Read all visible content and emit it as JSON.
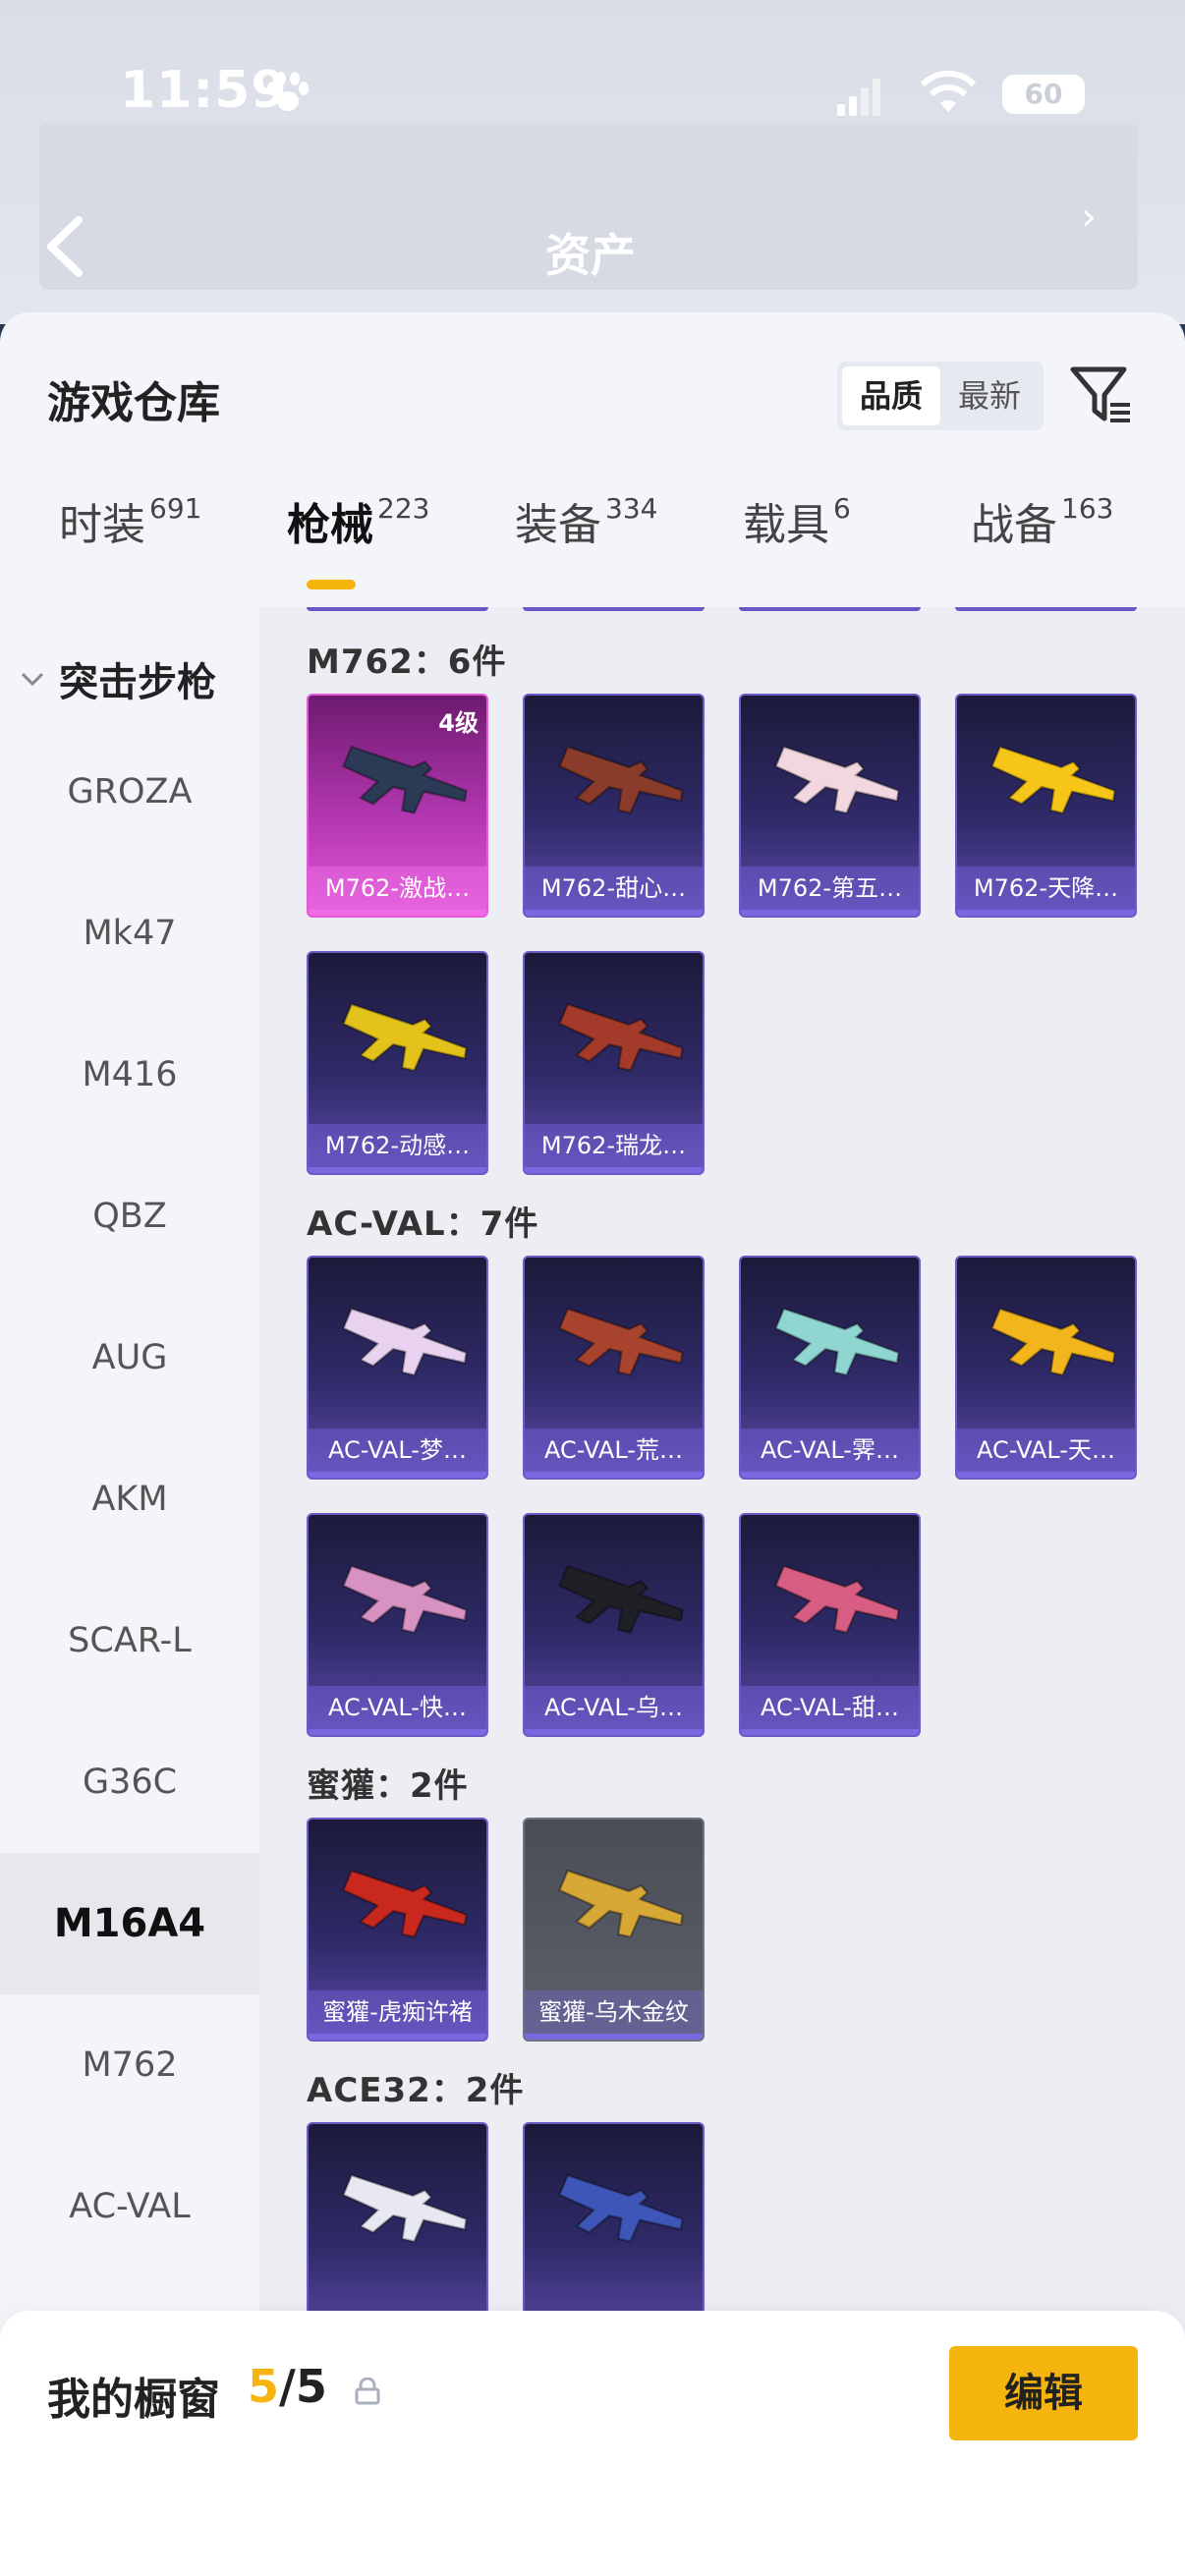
{
  "status": {
    "time": "11:59",
    "battery": "60"
  },
  "background_header": {
    "title": "资产"
  },
  "sheet": {
    "title": "游戏仓库",
    "sort": {
      "quality": "品质",
      "latest": "最新"
    }
  },
  "tabs": [
    {
      "label": "时装",
      "count": "691"
    },
    {
      "label": "枪械",
      "count": "223"
    },
    {
      "label": "装备",
      "count": "334"
    },
    {
      "label": "载具",
      "count": "6"
    },
    {
      "label": "战备",
      "count": "163"
    }
  ],
  "sidebar": {
    "category": "突击步枪",
    "items": [
      "GROZA",
      "Mk47",
      "M416",
      "QBZ",
      "AUG",
      "AKM",
      "SCAR-L",
      "G36C",
      "M16A4",
      "M762",
      "AC-VAL"
    ],
    "active": "M16A4"
  },
  "sections": [
    {
      "title": "M762：6件",
      "items": [
        {
          "name": "M762-激战…",
          "level": "4级",
          "style": "pink",
          "color": "#2b3a55"
        },
        {
          "name": "M762-甜心…",
          "style": "blue",
          "color": "#8a3b2a"
        },
        {
          "name": "M762-第五…",
          "style": "blue",
          "color": "#f2d6e0"
        },
        {
          "name": "M762-天降…",
          "style": "blue",
          "color": "#f5c518"
        },
        {
          "name": "M762-动感…",
          "style": "blue",
          "color": "#e3c21a"
        },
        {
          "name": "M762-瑞龙…",
          "style": "blue",
          "color": "#a33a2a"
        }
      ]
    },
    {
      "title": "AC-VAL：7件",
      "items": [
        {
          "name": "AC-VAL-梦…",
          "style": "blue",
          "color": "#e8d2ef"
        },
        {
          "name": "AC-VAL-荒…",
          "style": "blue",
          "color": "#a8432e"
        },
        {
          "name": "AC-VAL-霁…",
          "style": "blue",
          "color": "#8fd6d2"
        },
        {
          "name": "AC-VAL-天…",
          "style": "blue",
          "color": "#f2b51c"
        },
        {
          "name": "AC-VAL-快…",
          "style": "blue",
          "color": "#d792c2"
        },
        {
          "name": "AC-VAL-乌…",
          "style": "blue",
          "color": "#1f1f26"
        },
        {
          "name": "AC-VAL-甜…",
          "style": "blue",
          "color": "#d85d82"
        }
      ]
    },
    {
      "title": "蜜獾：2件",
      "items": [
        {
          "name": "蜜獾-虎痴许褚",
          "style": "blue",
          "color": "#c9281f"
        },
        {
          "name": "蜜獾-乌木金纹",
          "style": "gray",
          "color": "#d8a837"
        }
      ]
    },
    {
      "title": "ACE32：2件",
      "items": [
        {
          "name": "",
          "style": "blue",
          "color": "#e8e8f2"
        },
        {
          "name": "",
          "style": "blue",
          "color": "#3e56b8"
        }
      ]
    }
  ],
  "showcase": {
    "label": "我的橱窗",
    "current": "5",
    "total": "/5",
    "edit": "编辑"
  },
  "colors": {
    "accent": "#f6b40e",
    "card": "#2f2a68",
    "card_pink": "#b93ab6"
  }
}
